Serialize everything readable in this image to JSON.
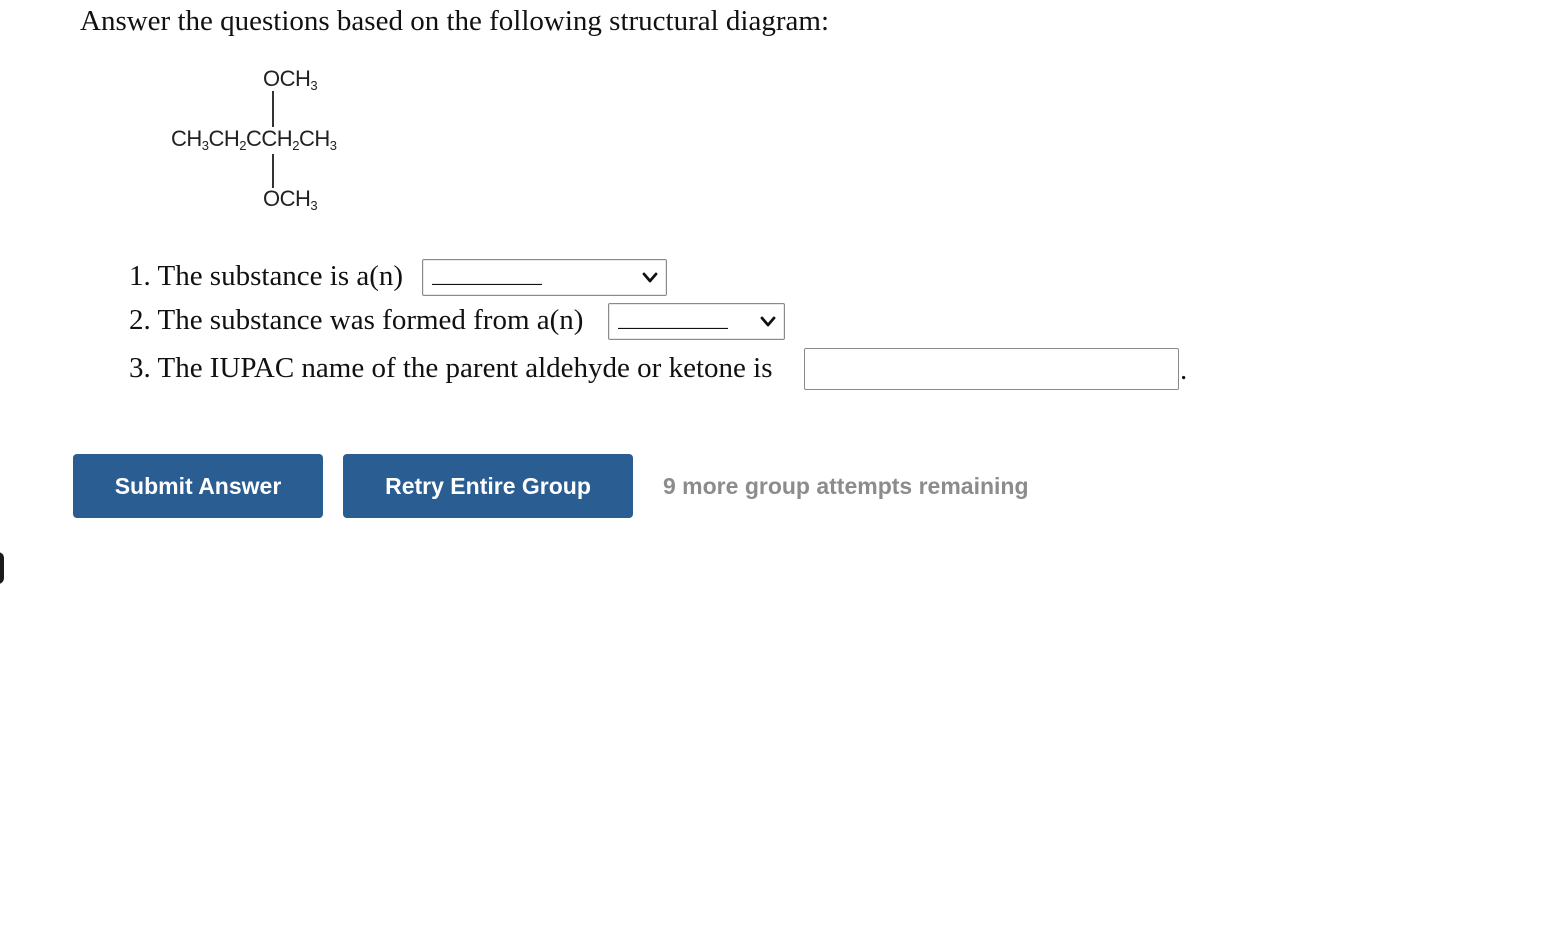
{
  "intro": "Answer the questions based on the following structural diagram:",
  "diagram": {
    "top_group": {
      "main": "OCH",
      "sub": "3"
    },
    "chain": [
      {
        "main": "CH",
        "sub": "3"
      },
      {
        "main": "CH",
        "sub": "2"
      },
      {
        "main": "C",
        "sub": ""
      },
      {
        "main": "CH",
        "sub": "2"
      },
      {
        "main": "CH",
        "sub": "3"
      }
    ],
    "bottom_group": {
      "main": "OCH",
      "sub": "3"
    }
  },
  "questions": {
    "q1": {
      "text": "1. The substance is a(n)",
      "selected": "__________"
    },
    "q2": {
      "text": "2. The substance was formed from a(n)",
      "selected": "__________"
    },
    "q3": {
      "text": "3. The IUPAC name of the parent aldehyde or ketone is",
      "value": "",
      "trailing": "."
    }
  },
  "actions": {
    "submit_label": "Submit Answer",
    "retry_label": "Retry Entire Group",
    "attempts_text": "9 more group attempts remaining"
  },
  "colors": {
    "button_bg": "#2a5d92",
    "button_text": "#ffffff",
    "attempts_text": "#8c8c8c"
  },
  "icons": {
    "select_chevron": "chevron-down-icon"
  }
}
